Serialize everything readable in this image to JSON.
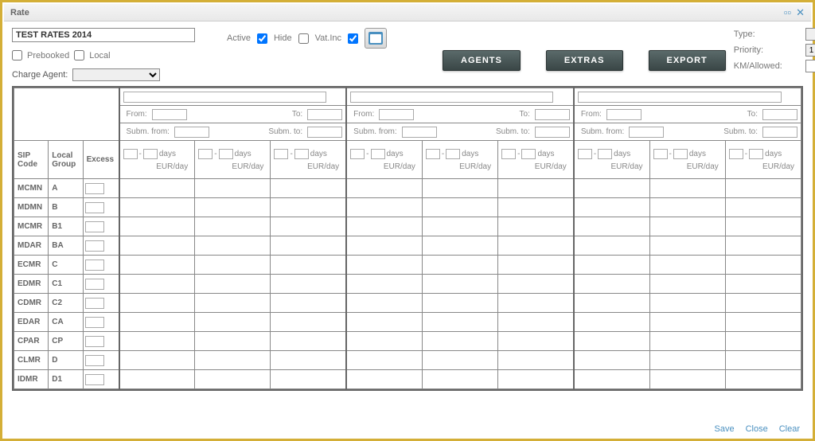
{
  "window": {
    "title": "Rate"
  },
  "form": {
    "rate_name": "TEST RATES 2014",
    "active_label": "Active",
    "hide_label": "Hide",
    "vatinc_label": "Vat.Inc",
    "prebooked_label": "Prebooked",
    "local_label": "Local",
    "charge_agent_label": "Charge Agent:",
    "type_label": "Type:",
    "priority_label": "Priority:",
    "priority_value": "1",
    "km_allowed_label": "KM/Allowed:"
  },
  "buttons": {
    "agents": "AGENTS",
    "extras": "EXTRAS",
    "export": "EXPORT"
  },
  "grid": {
    "sip_header": "SIP Code",
    "group_header": "Local Group",
    "excess_header": "Excess",
    "from_label": "From:",
    "to_label": "To:",
    "subm_from_label": "Subm. from:",
    "subm_to_label": "Subm. to:",
    "days_label": "days",
    "dash": "-",
    "eur_label": "EUR/day",
    "rows": [
      {
        "sip": "MCMN",
        "grp": "A"
      },
      {
        "sip": "MDMN",
        "grp": "B"
      },
      {
        "sip": "MCMR",
        "grp": "B1"
      },
      {
        "sip": "MDAR",
        "grp": "BA"
      },
      {
        "sip": "ECMR",
        "grp": "C"
      },
      {
        "sip": "EDMR",
        "grp": "C1"
      },
      {
        "sip": "CDMR",
        "grp": "C2"
      },
      {
        "sip": "EDAR",
        "grp": "CA"
      },
      {
        "sip": "CPAR",
        "grp": "CP"
      },
      {
        "sip": "CLMR",
        "grp": "D"
      },
      {
        "sip": "IDMR",
        "grp": "D1"
      }
    ]
  },
  "footer": {
    "save": "Save",
    "close": "Close",
    "clear": "Clear"
  }
}
